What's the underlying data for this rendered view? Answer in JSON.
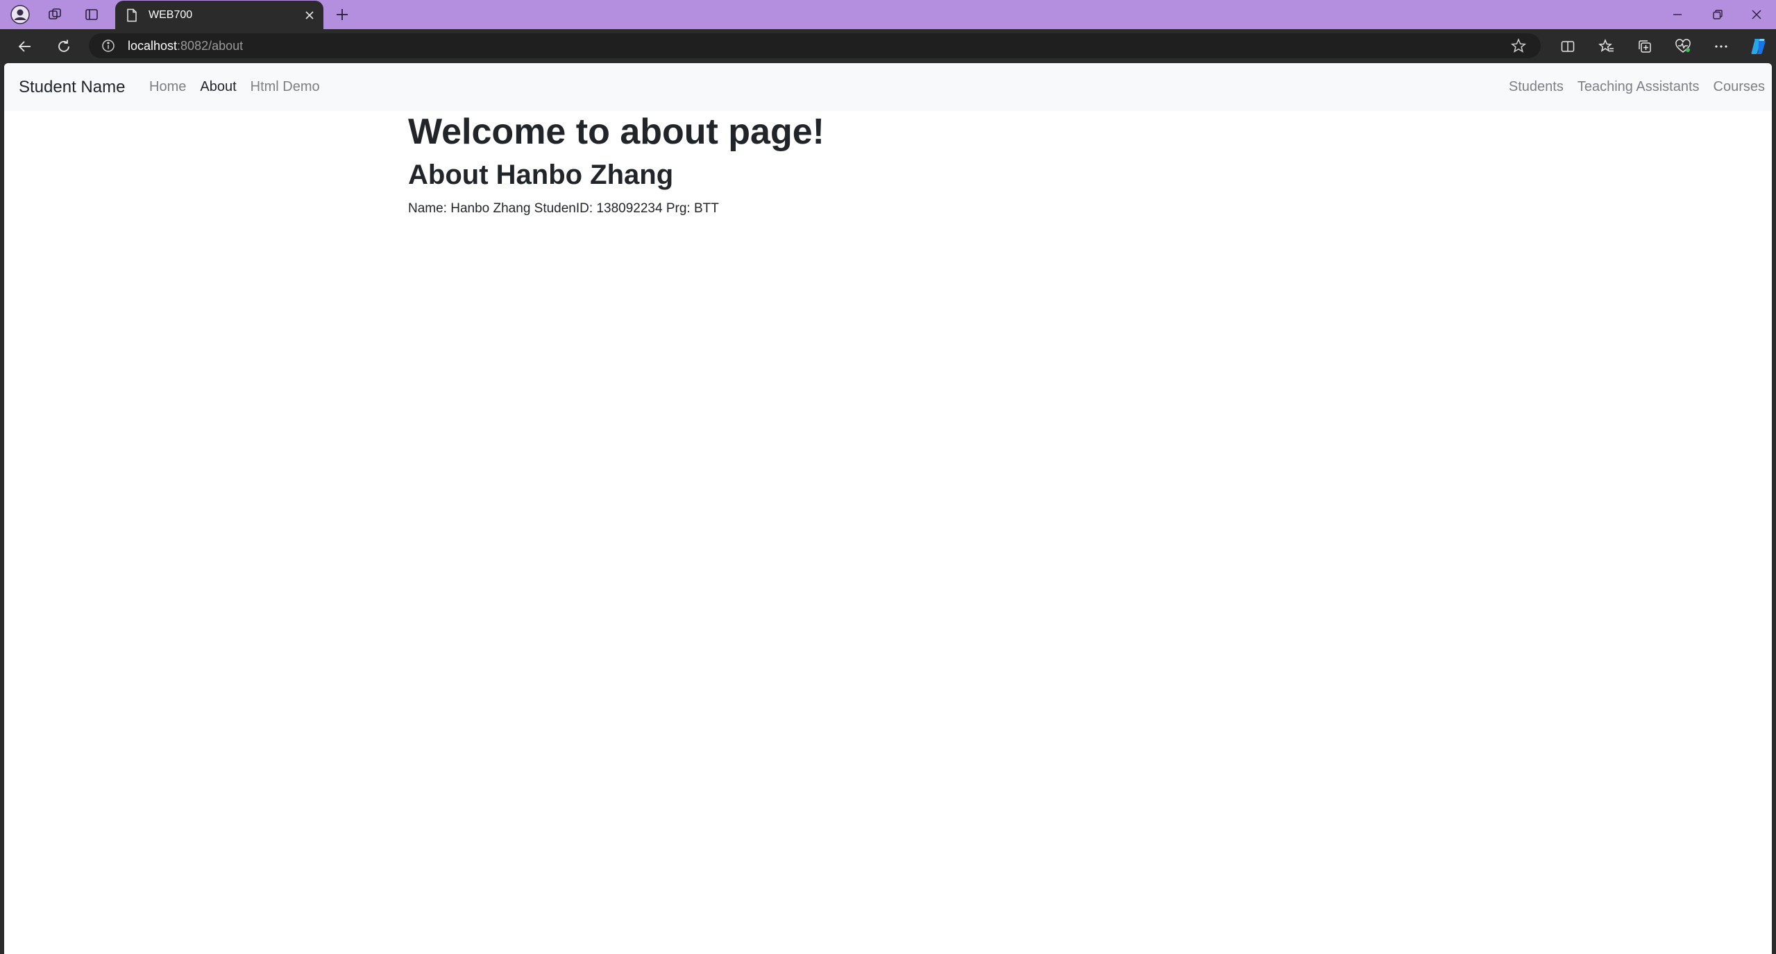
{
  "browser": {
    "tab": {
      "title": "WEB700"
    },
    "address": {
      "host": "localhost",
      "rest": ":8082/about"
    }
  },
  "navbar": {
    "brand": "Student Name",
    "left_links": [
      "Home",
      "About",
      "Html Demo"
    ],
    "active": "About",
    "right_links": [
      "Students",
      "Teaching Assistants",
      "Courses"
    ]
  },
  "main": {
    "heading": "Welcome to about page!",
    "subheading": "About Hanbo Zhang",
    "info": "Name: Hanbo Zhang StudenID: 138092234 Prg: BTT"
  },
  "colors": {
    "tabstrip": "#b48fe0",
    "toolbar": "#2b2b2b",
    "navbar_bg": "#f8f9fa",
    "text": "#212529",
    "nav_muted": "#7c7f83"
  }
}
